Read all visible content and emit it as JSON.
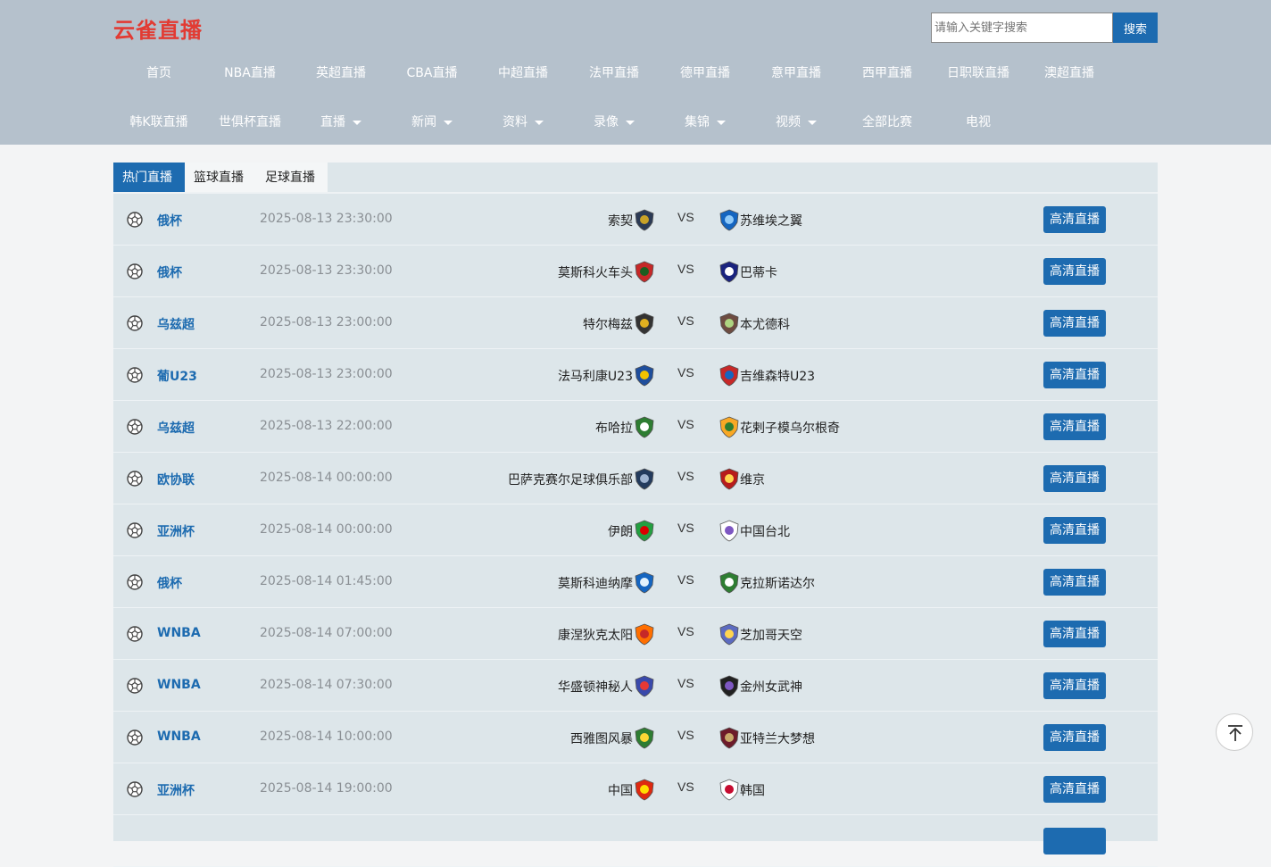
{
  "header": {
    "logo": "云雀直播",
    "search_placeholder": "请输入关键字搜索",
    "search_button": "搜索"
  },
  "nav": {
    "row1": [
      "首页",
      "NBA直播",
      "英超直播",
      "CBA直播",
      "中超直播",
      "法甲直播",
      "德甲直播",
      "意甲直播",
      "西甲直播",
      "日职联直播",
      "澳超直播"
    ],
    "row2": [
      {
        "label": "韩K联直播",
        "dropdown": false
      },
      {
        "label": "世俱杯直播",
        "dropdown": false
      },
      {
        "label": "直播",
        "dropdown": true
      },
      {
        "label": "新闻",
        "dropdown": true
      },
      {
        "label": "资料",
        "dropdown": true
      },
      {
        "label": "录像",
        "dropdown": true
      },
      {
        "label": "集锦",
        "dropdown": true
      },
      {
        "label": "视频",
        "dropdown": true
      },
      {
        "label": "全部比赛",
        "dropdown": false
      },
      {
        "label": "电视",
        "dropdown": false
      }
    ]
  },
  "tabs": [
    "热门直播",
    "篮球直播",
    "足球直播"
  ],
  "active_tab": "热门直播",
  "vs_label": "VS",
  "matches": [
    {
      "league": "俄杯",
      "time": "2025-08-13 23:30:00",
      "home": "索契",
      "away": "苏维埃之翼",
      "button": "高清直播"
    },
    {
      "league": "俄杯",
      "time": "2025-08-13 23:30:00",
      "home": "莫斯科火车头",
      "away": "巴蒂卡",
      "button": "高清直播"
    },
    {
      "league": "乌兹超",
      "time": "2025-08-13 23:00:00",
      "home": "特尔梅兹",
      "away": "本尤德科",
      "button": "高清直播"
    },
    {
      "league": "葡U23",
      "time": "2025-08-13 23:00:00",
      "home": "法马利康U23",
      "away": "吉维森特U23",
      "button": "高清直播"
    },
    {
      "league": "乌兹超",
      "time": "2025-08-13 22:00:00",
      "home": "布哈拉",
      "away": "花剌子模乌尔根奇",
      "button": "高清直播"
    },
    {
      "league": "欧协联",
      "time": "2025-08-14 00:00:00",
      "home": "巴萨克赛尔足球俱乐部",
      "away": "维京",
      "button": "高清直播"
    },
    {
      "league": "亚洲杯",
      "time": "2025-08-14 00:00:00",
      "home": "伊朗",
      "away": "中国台北",
      "button": "高清直播"
    },
    {
      "league": "俄杯",
      "time": "2025-08-14 01:45:00",
      "home": "莫斯科迪纳摩",
      "away": "克拉斯诺达尔",
      "button": "高清直播"
    },
    {
      "league": "WNBA",
      "time": "2025-08-14 07:00:00",
      "home": "康涅狄克太阳",
      "away": "芝加哥天空",
      "button": "高清直播"
    },
    {
      "league": "WNBA",
      "time": "2025-08-14 07:30:00",
      "home": "华盛顿神秘人",
      "away": "金州女武神",
      "button": "高清直播"
    },
    {
      "league": "WNBA",
      "time": "2025-08-14 10:00:00",
      "home": "西雅图风暴",
      "away": "亚特兰大梦想",
      "button": "高清直播"
    },
    {
      "league": "亚洲杯",
      "time": "2025-08-14 19:00:00",
      "home": "中国",
      "away": "韩国",
      "button": "高清直播"
    }
  ]
}
